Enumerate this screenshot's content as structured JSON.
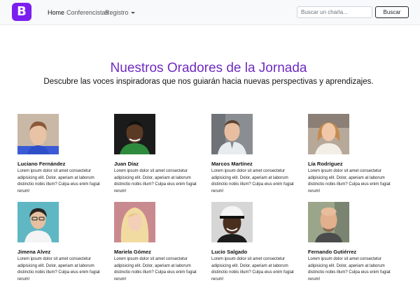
{
  "navbar": {
    "brand_letter": "B",
    "brand_color": "#7a1ff0",
    "links": [
      {
        "label": "Home",
        "active": true
      },
      {
        "label": "Conferencistas",
        "active": false
      },
      {
        "label": "Registro",
        "active": false,
        "dropdown": true
      }
    ],
    "search": {
      "placeholder": "Buscar un charla...",
      "value": ""
    },
    "search_button": "Buscar"
  },
  "hero": {
    "title": "Nuestros Oradores de la Jornada",
    "subtitle": "Descubre las voces inspiradoras que nos guiarán hacia nuevas perspectivas y aprendizajes."
  },
  "speakers": [
    {
      "name": "Luciano Fernández",
      "bio": "Lorem ipsum dolor sit amet consectetur adipisicing elit. Dolor, aperiam at laborum distinctio nobis illum? Culpa eius enim fugiat rerum!",
      "photo_icon": "person-portrait"
    },
    {
      "name": "Juan Díaz",
      "bio": "Lorem ipsum dolor sit amet consectetur adipisicing elit. Dolor, aperiam at laborum distinctio nobis illum? Culpa eius enim fugiat rerum!",
      "photo_icon": "person-portrait"
    },
    {
      "name": "Marcos Martínez",
      "bio": "Lorem ipsum dolor sit amet consectetur adipisicing elit. Dolor, aperiam at laborum distinctio nobis illum? Culpa eius enim fugiat rerum!",
      "photo_icon": "person-portrait"
    },
    {
      "name": "Lía Rodríguez",
      "bio": "Lorem ipsum dolor sit amet consectetur adipisicing elit. Dolor, aperiam at laborum distinctio nobis illum? Culpa eius enim fugiat rerum!",
      "photo_icon": "person-portrait"
    },
    {
      "name": "Jimena Alvez",
      "bio": "Lorem ipsum dolor sit amet consectetur adipisicing elit. Dolor, aperiam at laborum distinctio nobis illum? Culpa eius enim fugiat rerum!",
      "photo_icon": "person-portrait"
    },
    {
      "name": "Mariela Gómez",
      "bio": "Lorem ipsum dolor sit amet consectetur adipisicing elit. Dolor, aperiam at laborum distinctio nobis illum? Culpa eius enim fugiat rerum!",
      "photo_icon": "person-portrait"
    },
    {
      "name": "Lucio Salgado",
      "bio": "Lorem ipsum dolor sit amet consectetur adipisicing elit. Dolor, aperiam at laborum distinctio nobis illum? Culpa eius enim fugiat rerum!",
      "photo_icon": "person-portrait"
    },
    {
      "name": "Fernando Gutiérrez",
      "bio": "Lorem ipsum dolor sit amet consectetur adipisicing elit. Dolor, aperiam at laborum distinctio nobis illum? Culpa eius enim fugiat rerum!",
      "photo_icon": "person-portrait"
    }
  ],
  "colors": {
    "title": "#6f2bc0",
    "navbar_bg": "#f8f9fa"
  }
}
